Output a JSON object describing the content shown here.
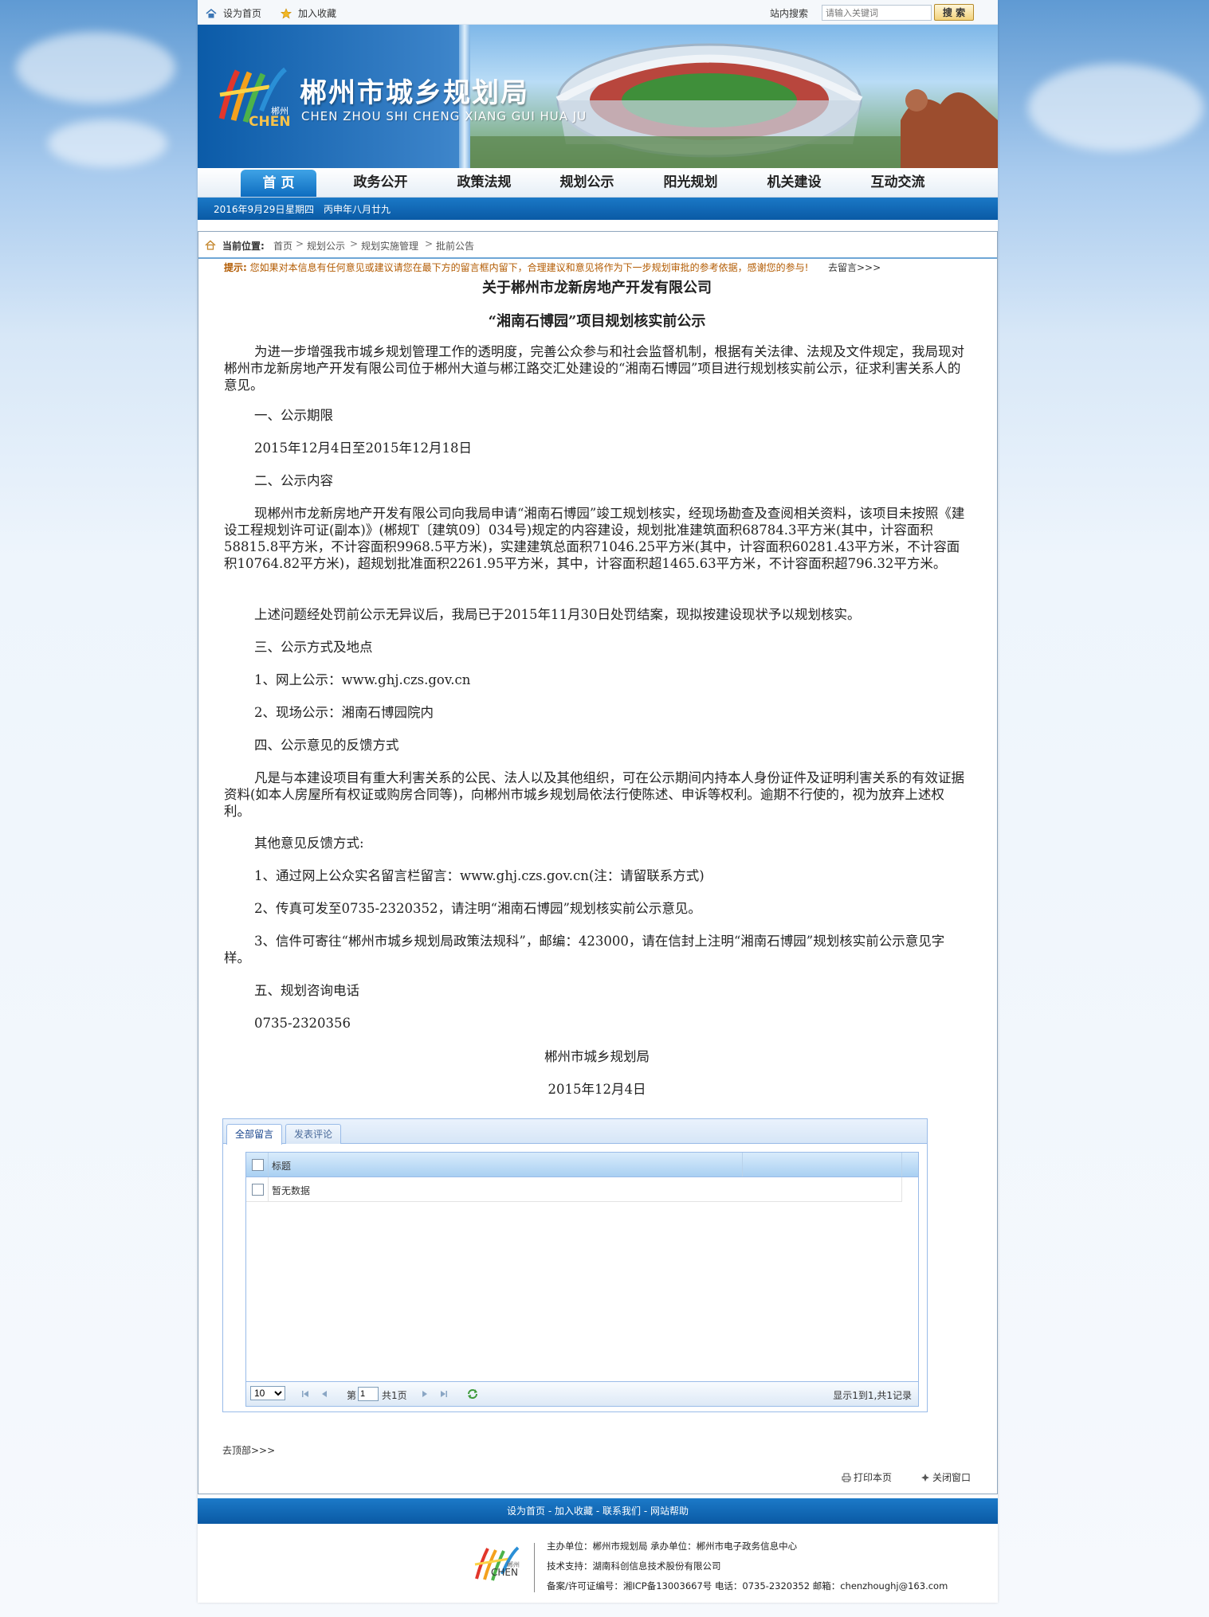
{
  "topbar": {
    "set_home": "设为首页",
    "add_fav": "加入收藏",
    "search_label": "站内搜索",
    "search_placeholder": "请输入关键词",
    "search_button": "搜 索"
  },
  "banner": {
    "title": "郴州市城乡规划局",
    "subtitle": "CHEN ZHOU SHI CHENG XIANG GUI HUA JU",
    "logo_cn": "郴州",
    "logo_en": "CHEN"
  },
  "nav": {
    "items": [
      "首 页",
      "政务公开",
      "政策法规",
      "规划公示",
      "阳光规划",
      "机关建设",
      "互动交流"
    ]
  },
  "datebar": {
    "date": "2016年9月29日",
    "weekday": "星期四",
    "lunar": "丙申年八月廿九"
  },
  "breadcrumb": {
    "label": "当前位置:",
    "items": [
      "首页",
      "规划公示",
      "规划实施管理",
      "批前公告"
    ],
    "sep": ">"
  },
  "tip": {
    "prefix": "提示:",
    "text": "您如果对本信息有任何意见或建议请您在最下方的留言框内留下，合理建议和意见将作为下一步规划审批的参考依据，感谢您的参与!",
    "link": "去留言>>>"
  },
  "article": {
    "title1": "关于郴州市龙新房地产开发有限公司",
    "title2": "“湘南石博园”项目规划核实前公示",
    "p1": "为进一步增强我市城乡规划管理工作的透明度，完善公众参与和社会监督机制，根据有关法律、法规及文件规定，我局现对郴州市龙新房地产开发有限公司位于郴州大道与郴江路交汇处建设的“湘南石博园”项目进行规划核实前公示，征求利害关系人的意见。",
    "h1": "一、公示期限",
    "p2": "2015年12月4日至2015年12月18日",
    "h2": "二、公示内容",
    "p3": "现郴州市龙新房地产开发有限公司向我局申请“湘南石博园”竣工规划核实，经现场勘查及查阅相关资料，该项目未按照《建设工程规划许可证(副本)》(郴规T〔建筑09〕034号)规定的内容建设，规划批准建筑面积68784.3平方米(其中，计容面积58815.8平方米，不计容面积9968.5平方米)，实建建筑总面积71046.25平方米(其中，计容面积60281.43平方米，不计容面积10764.82平方米)，超规划批准面积2261.95平方米，其中，计容面积超1465.63平方米，不计容面积超796.32平方米。",
    "p4": "上述问题经处罚前公示无异议后，我局已于2015年11月30日处罚结案，现拟按建设现状予以规划核实。",
    "h3": "三、公示方式及地点",
    "p5": "1、网上公示：www.ghj.czs.gov.cn",
    "p6": "2、现场公示：湘南石博园院内",
    "h4": "四、公示意见的反馈方式",
    "p7": "凡是与本建设项目有重大利害关系的公民、法人以及其他组织，可在公示期间内持本人身份证件及证明利害关系的有效证据资料(如本人房屋所有权证或购房合同等)，向郴州市城乡规划局依法行使陈述、申诉等权利。逾期不行使的，视为放弃上述权利。",
    "p8": "其他意见反馈方式:",
    "p9": "1、通过网上公众实名留言栏留言：www.ghj.czs.gov.cn(注：请留联系方式)",
    "p10": "2、传真可发至0735-2320352，请注明“湘南石博园”规划核实前公示意见。",
    "p11": "3、信件可寄往“郴州市城乡规划局政策法规科”，邮编：423000，请在信封上注明“湘南石博园”规划核实前公示意见字样。",
    "h5": "五、规划咨询电话",
    "p12": "0735-2320356",
    "sign": "郴州市城乡规划局",
    "date": "2015年12月4日"
  },
  "comments": {
    "tab_all": "全部留言",
    "tab_post": "发表评论",
    "col_title": "标题",
    "empty": "暂无数据",
    "page_size": "10",
    "page_prefix": "第",
    "page_num": "1",
    "page_total": "共1页",
    "summary": "显示1到1,共1记录"
  },
  "links": {
    "gotop": "去顶部>>>",
    "print": "打印本页",
    "close": "关闭窗口"
  },
  "footer": {
    "nav": [
      "设为首页",
      "加入收藏",
      "联系我们",
      "网站帮助"
    ],
    "line1": "主办单位：郴州市规划局  承办单位：郴州市电子政务信息中心",
    "line2": "技术支持：湖南科创信息技术股份有限公司",
    "line3": "备案/许可证编号：湘ICP备13003667号  电话：0735-2320352  邮箱：chenzhoughj@163.com",
    "logo_cn": "郴州",
    "logo_en": "CHEN"
  }
}
